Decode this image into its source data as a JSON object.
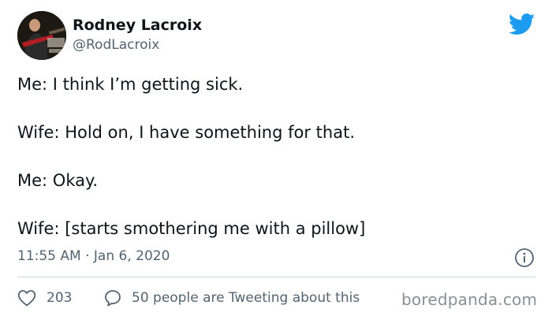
{
  "user": {
    "name": "Rodney Lacroix",
    "handle": "@RodLacroix"
  },
  "tweet": {
    "lines": [
      "Me: I think I’m getting sick.",
      "Wife: Hold on, I have something for that.",
      "Me: Okay.",
      "Wife: [starts smothering me with a pillow]"
    ],
    "timestamp": "11:55 AM · Jan 6, 2020"
  },
  "actions": {
    "likes": "203",
    "replies_text": "50 people are Tweeting about this"
  },
  "watermark": "boredpanda.com",
  "colors": {
    "brand_blue": "#1d9bf0",
    "text": "#0f1419",
    "muted": "#536471",
    "divider": "#cfd9de"
  },
  "icons": [
    "twitter-bird-icon",
    "info-icon",
    "heart-icon",
    "reply-bubble-icon"
  ]
}
